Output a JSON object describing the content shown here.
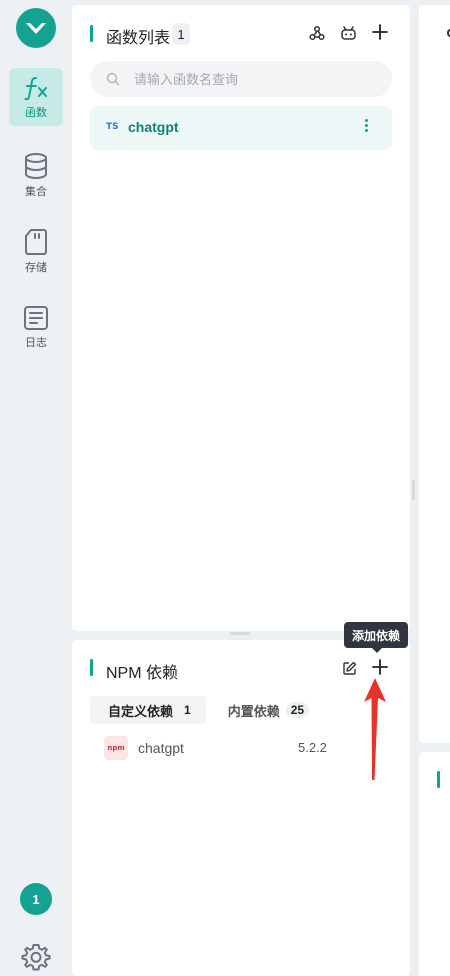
{
  "nav": {
    "items": [
      {
        "label": "函数",
        "icon": "function-icon",
        "active": true
      },
      {
        "label": "集合",
        "icon": "database-icon",
        "active": false
      },
      {
        "label": "存储",
        "icon": "storage-card-icon",
        "active": false
      },
      {
        "label": "日志",
        "icon": "log-document-icon",
        "active": false
      }
    ],
    "notification_count": "1"
  },
  "functions_panel": {
    "title": "函数列表",
    "count": "1",
    "search_placeholder": "请输入函数名查询",
    "items": [
      {
        "lang_tag": "TS",
        "name": "chatgpt"
      }
    ]
  },
  "npm_panel": {
    "title": "NPM 依赖",
    "tabs": [
      {
        "label": "自定义依赖",
        "count": "1",
        "active": true
      },
      {
        "label": "内置依赖",
        "count": "25",
        "active": false
      }
    ],
    "dependencies": [
      {
        "logo_text": "npm",
        "name": "chatgpt",
        "version": "5.2.2"
      }
    ],
    "add_tooltip": "添加依赖"
  },
  "colors": {
    "accent": "#14a393",
    "annotation_arrow": "#e5332a"
  }
}
